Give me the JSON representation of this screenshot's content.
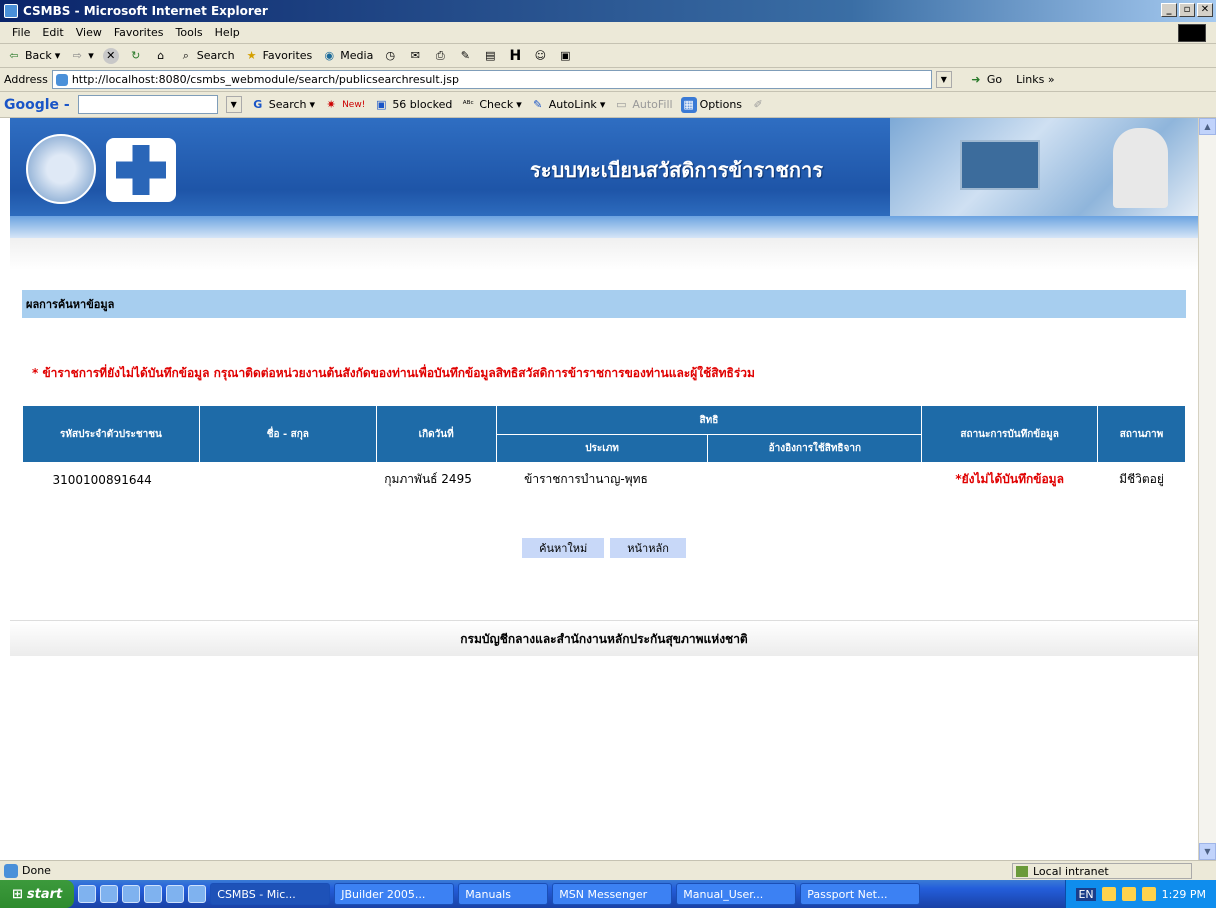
{
  "window": {
    "title": "CSMBS - Microsoft Internet Explorer",
    "buttons": [
      "_",
      "8",
      "X"
    ]
  },
  "menu": [
    "File",
    "Edit",
    "View",
    "Favorites",
    "Tools",
    "Help"
  ],
  "toolbar": {
    "back": "Back",
    "search": "Search",
    "favorites": "Favorites",
    "media": "Media"
  },
  "address": {
    "label": "Address",
    "url": "http://localhost:8080/csmbs_webmodule/search/publicsearchresult.jsp",
    "go": "Go",
    "links": "Links »"
  },
  "google": {
    "logo": "Google -",
    "search": "Search",
    "new": "New!",
    "blocked": "56 blocked",
    "check": "Check",
    "autolink": "AutoLink",
    "autofill": "AutoFill",
    "options": "Options"
  },
  "banner": {
    "title": "ระบบทะเบียนสวัสดิการข้าราชการ"
  },
  "section": {
    "heading": "ผลการค้นหาข้อมูล"
  },
  "notice": "* ข้าราชการที่ยังไม่ได้บันทึกข้อมูล กรุณาติดต่อหน่วยงานต้นสังกัดของท่านเพื่อบันทึกข้อมูลสิทธิสวัสดิการข้าราชการของท่านและผู้ใช้สิทธิร่วม",
  "table": {
    "headers": {
      "id": "รหัสประจำตัวประชาชน",
      "name": "ชื่อ - สกุล",
      "birth": "เกิดวันที่",
      "rights": "สิทธิ",
      "type": "ประเภท",
      "source": "อ้างอิงการใช้สิทธิจาก",
      "record_status": "สถานะการบันทึกข้อมูล",
      "life_status": "สถานภาพ"
    },
    "rows": [
      {
        "id": "3100100891644",
        "name": "",
        "birth": "กุมภาพันธ์ 2495",
        "type": "ข้าราชการบำนาญ-พุทธ",
        "source": "",
        "record_status": "*ยังไม่ได้บันทึกข้อมูล",
        "life_status": "มีชีวิตอยู่"
      }
    ]
  },
  "buttons": {
    "new_search": "ค้นหาใหม่",
    "home": "หน้าหลัก"
  },
  "footer": "กรมบัญชีกลางและสำนักงานหลักประกันสุขภาพแห่งชาติ",
  "status": {
    "left": "Done",
    "zone": "Local intranet"
  },
  "taskbar": {
    "start": "start",
    "tasks": [
      "CSMBS - Mic...",
      "JBuilder 2005...",
      "Manuals",
      "MSN Messenger",
      "Manual_User...",
      "Passport Net..."
    ],
    "lang": "EN",
    "clock": "1:29 PM"
  }
}
